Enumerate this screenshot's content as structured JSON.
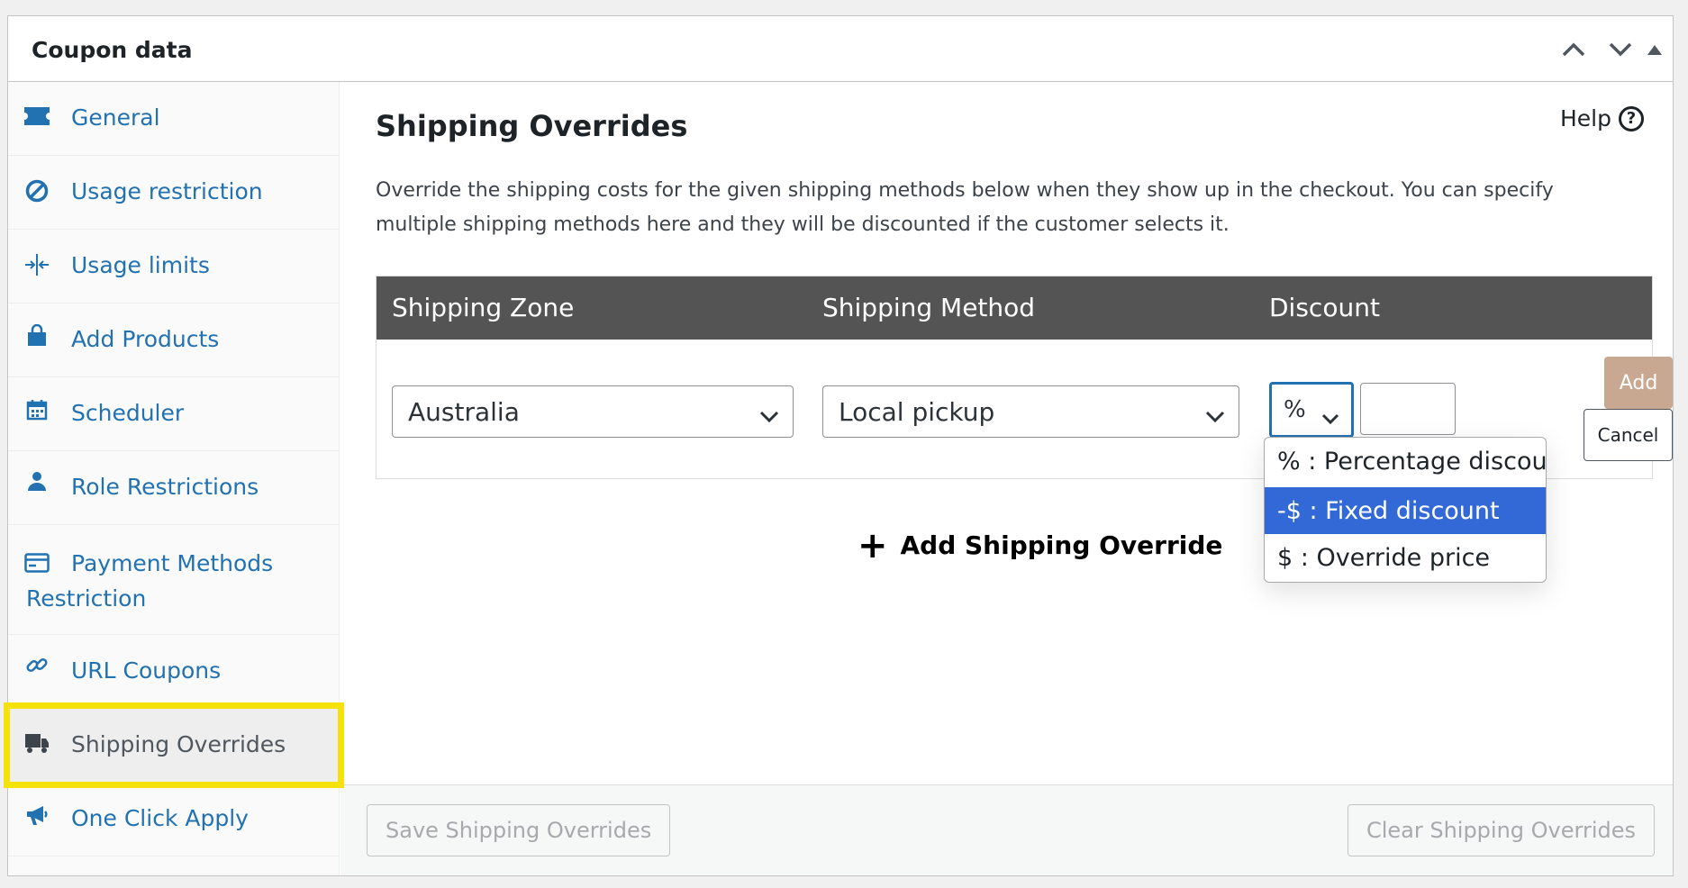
{
  "panel": {
    "title": "Coupon data"
  },
  "sidebar": {
    "items": [
      {
        "label": "General",
        "icon": "ticket-icon"
      },
      {
        "label": "Usage restriction",
        "icon": "prohibited-icon"
      },
      {
        "label": "Usage limits",
        "icon": "arrows-in-icon"
      },
      {
        "label": "Add Products",
        "icon": "shopping-bag-icon"
      },
      {
        "label": "Scheduler",
        "icon": "calendar-icon"
      },
      {
        "label": "Role Restrictions",
        "icon": "person-icon"
      },
      {
        "label": "Payment Methods",
        "label2": "Restriction",
        "icon": "credit-card-icon"
      },
      {
        "label": "URL Coupons",
        "icon": "link-icon"
      },
      {
        "label": "Shipping Overrides",
        "icon": "truck-icon"
      },
      {
        "label": "One Click Apply",
        "icon": "megaphone-icon"
      }
    ],
    "active": "Shipping Overrides",
    "highlight_color": "#f5e20a"
  },
  "main": {
    "title": "Shipping Overrides",
    "help_label": "Help",
    "description": "Override the shipping costs for the given shipping methods below when they show up in the checkout. You can specify multiple shipping methods here and they will be discounted if the customer selects it.",
    "table": {
      "headers": [
        "Shipping Zone",
        "Shipping Method",
        "Discount"
      ],
      "row": {
        "zone": "Australia",
        "method": "Local pickup",
        "discount_type": "%",
        "amount": ""
      }
    },
    "add_button": "Add",
    "cancel_button": "Cancel",
    "dropdown_options": [
      "% : Percentage discount",
      "-$ : Fixed discount",
      "$ : Override price"
    ],
    "dropdown_selected": "-$ : Fixed discount",
    "add_override_label": "Add Shipping Override",
    "save_button": "Save Shipping Overrides",
    "clear_button": "Clear Shipping Overrides"
  },
  "colors": {
    "link": "#2271b1",
    "table_header": "#545454",
    "add_button": "#c9a891",
    "dropdown_selected": "#3269d6"
  }
}
